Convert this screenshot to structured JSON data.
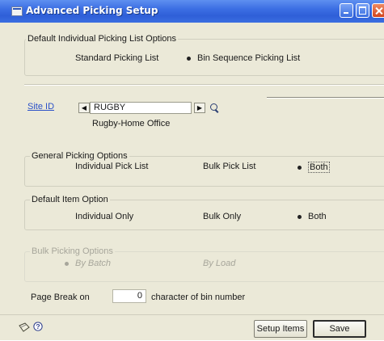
{
  "window": {
    "title": "Advanced Picking Setup"
  },
  "default_individual": {
    "label": "Default Individual Picking List Options",
    "options": [
      "Standard Picking List",
      "Bin Sequence Picking List"
    ],
    "selected": "Bin Sequence Picking List"
  },
  "site": {
    "label": "Site ID",
    "value": "RUGBY",
    "description": "Rugby-Home Office"
  },
  "general_picking": {
    "label": "General Picking Options",
    "options": [
      "Individual Pick List",
      "Bulk Pick List",
      "Both"
    ],
    "selected": "Both"
  },
  "default_item": {
    "label": "Default Item Option",
    "options": [
      "Individual Only",
      "Bulk Only",
      "Both"
    ],
    "selected": "Both"
  },
  "bulk_picking": {
    "label": "Bulk Picking Options",
    "options": [
      "By Batch",
      "By Load"
    ],
    "selected": "By Batch",
    "disabled": true
  },
  "page_break": {
    "label_before": "Page Break on",
    "value": "0",
    "label_after": "character of bin number"
  },
  "buttons": {
    "setup_items": "Setup Items",
    "save": "Save"
  },
  "icons": {
    "note": "note-icon",
    "help": "help-icon"
  }
}
